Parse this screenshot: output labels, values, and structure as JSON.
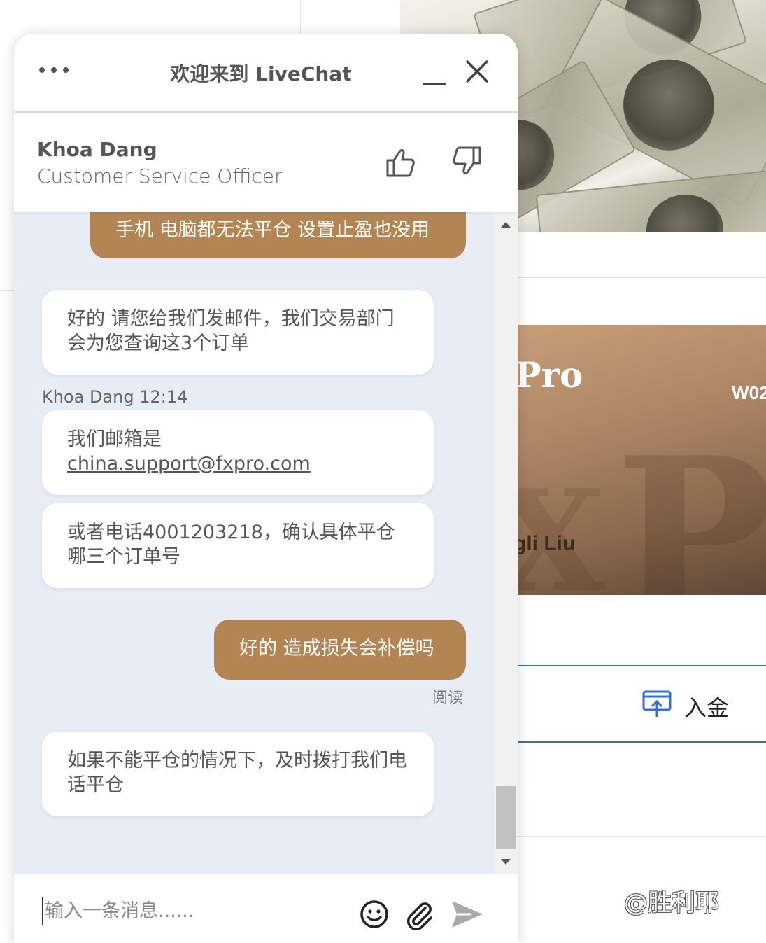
{
  "chat": {
    "title": "欢迎来到 LiveChat",
    "agent": {
      "name": "Khoa Dang",
      "role": "Customer Service Officer"
    },
    "messages": [
      {
        "from": "user",
        "text": "手机 电脑都无法平仓 设置止盈也没用"
      },
      {
        "from": "agent",
        "text": "好的 请您给我们发邮件，我们交易部门会为您查询这3个订单"
      },
      {
        "from": "meta",
        "text": "Khoa Dang 12:14"
      },
      {
        "from": "agent",
        "text_prefix": "我们邮箱是",
        "link": "china.support@fxpro.com"
      },
      {
        "from": "agent",
        "text": "或者电话4001203218，确认具体平仓哪三个订单号"
      },
      {
        "from": "user",
        "text": "好的 造成损失会补偿吗"
      },
      {
        "from": "status",
        "text": "阅读"
      },
      {
        "from": "agent",
        "text": "如果不能平仓的情况下，及时拨打我们电话平仓"
      }
    ],
    "composer": {
      "placeholder": "输入一条消息......"
    }
  },
  "background": {
    "card": {
      "brand_fragment": "Pro",
      "code_fragment": "W02",
      "name_fragment": "gli Liu"
    },
    "deposit_label": "入金",
    "watermark": "@胜利耶"
  },
  "icons": {
    "menu": "more-dots-icon",
    "minimize": "minimize-icon",
    "close": "close-icon",
    "rate_good": "thumbs-up-icon",
    "rate_bad": "thumbs-down-icon",
    "emoji": "emoji-icon",
    "attach": "paperclip-icon",
    "send": "send-icon",
    "deposit": "deposit-upload-icon"
  },
  "colors": {
    "user_bubble": "#b28553",
    "agent_bubble": "#ffffff",
    "chat_bg": "#e8edf5",
    "accent_blue": "#2f6fdb"
  }
}
